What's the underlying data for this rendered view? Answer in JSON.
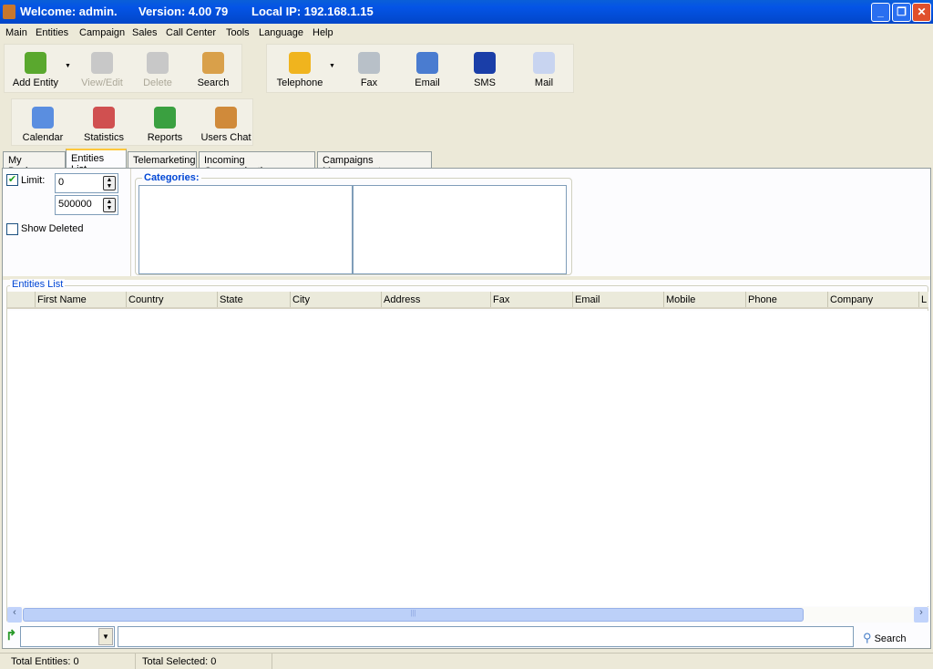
{
  "title": {
    "welcome": "Welcome: admin.",
    "version": "Version: 4.00 79",
    "ip": "Local IP: 192.168.1.15"
  },
  "menu": [
    "Main",
    "Entities",
    "Campaign",
    "Sales",
    "Call Center",
    "Tools",
    "Language",
    "Help"
  ],
  "toolbar1": [
    {
      "label": "Add Entity",
      "icon": "add-user-icon",
      "enabled": true
    },
    {
      "label": "View/Edit",
      "icon": "edit-user-icon",
      "enabled": false
    },
    {
      "label": "Delete",
      "icon": "delete-user-icon",
      "enabled": false
    },
    {
      "label": "Search",
      "icon": "search-user-icon",
      "enabled": true
    }
  ],
  "toolbar2": [
    {
      "label": "Telephone",
      "icon": "telephone-icon"
    },
    {
      "label": "Fax",
      "icon": "fax-icon"
    },
    {
      "label": "Email",
      "icon": "email-icon"
    },
    {
      "label": "SMS",
      "icon": "mobile-phone-icon"
    },
    {
      "label": "Mail",
      "icon": "envelope-icon"
    }
  ],
  "toolbar3": [
    {
      "label": "Calendar",
      "icon": "calendar-icon"
    },
    {
      "label": "Statistics",
      "icon": "bar-chart-icon"
    },
    {
      "label": "Reports",
      "icon": "report-icon"
    },
    {
      "label": "Users Chat",
      "icon": "chat-icon"
    }
  ],
  "tabs": [
    {
      "label": "My Business"
    },
    {
      "label": "Entities List",
      "active": true
    },
    {
      "label": "Telemarketing"
    },
    {
      "label": "Incoming Communication"
    },
    {
      "label": "Campaigns Management"
    }
  ],
  "filters": {
    "limit_label": "Limit:",
    "limit_checked": true,
    "limit_from": "0",
    "limit_to": "500000",
    "show_deleted_label": "Show Deleted",
    "show_deleted_checked": false,
    "categories_label": "Categories:"
  },
  "list": {
    "title": "Entities List",
    "columns": [
      "First Name",
      "Country",
      "State",
      "City",
      "Address",
      "Fax",
      "Email",
      "Mobile",
      "Phone",
      "Company",
      "L"
    ]
  },
  "search": {
    "field_value": "",
    "query": "",
    "button": "Search"
  },
  "status": {
    "total_entities": "Total Entities:  0",
    "total_selected": "Total Selected:  0"
  },
  "colors": {
    "titlebar": "#0454e6",
    "accent_blue": "#0046d5",
    "tab_highlight": "#ffc83c"
  }
}
